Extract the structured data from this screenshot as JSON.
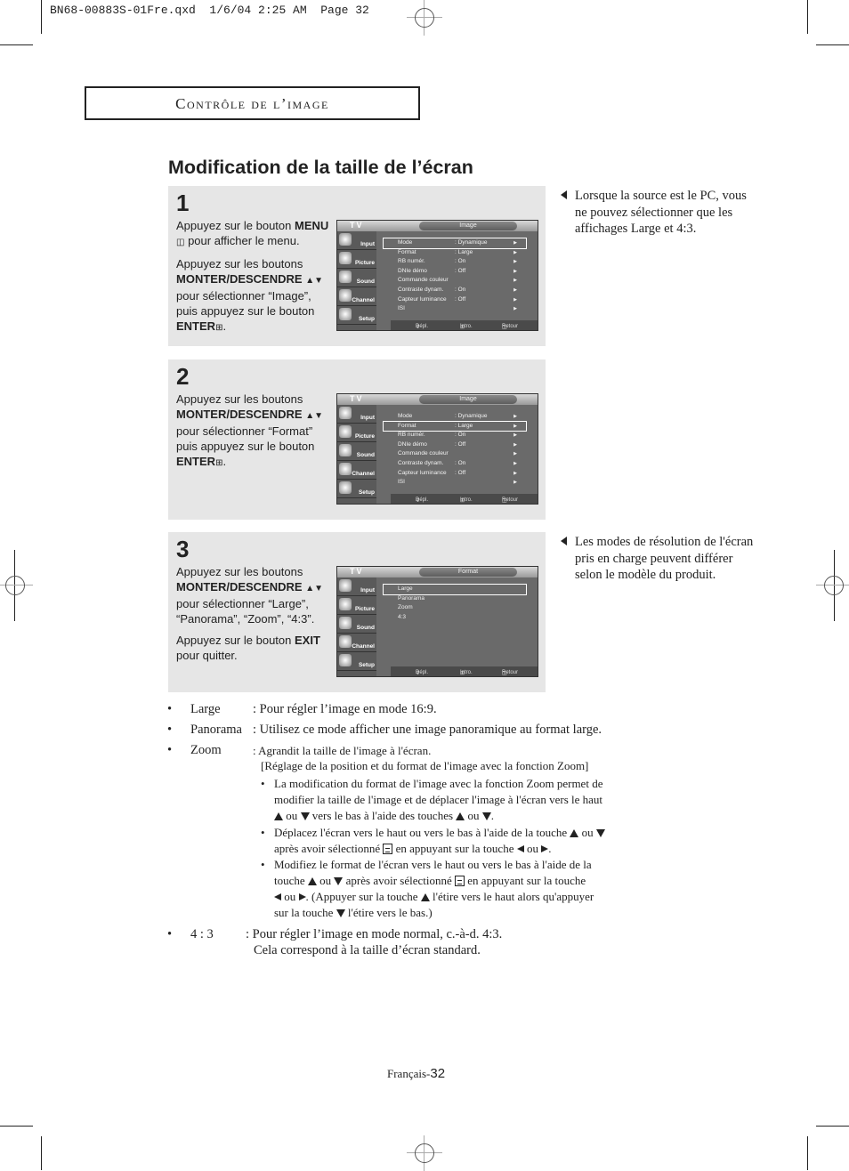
{
  "slug": "BN68-00883S-01Fre.qxd  1/6/04 2:25 AM  Page 32",
  "section_header": "Contrôle de l’image",
  "page_title": "Modification de la taille de l’écran",
  "steps": [
    {
      "number": "1",
      "paragraphs": [
        {
          "pre": "Appuyez sur le bouton ",
          "bold": "MENU",
          "icon": "menu-icon",
          "post": " pour afficher le menu."
        },
        {
          "pre": "Appuyez sur les boutons ",
          "bold": "MONTER/DESCENDRE",
          "icon": "up-down-icon",
          "post": " pour sélectionner “Image”, puis appuyez sur le bouton ",
          "bold2": "ENTER",
          "icon2": "enter-icon",
          "post2": "."
        }
      ],
      "screen": {
        "label": "TV",
        "tab": "Image",
        "rows": [
          {
            "key": "Mode",
            "value": ": Dynamique",
            "selected": true
          },
          {
            "key": "Format",
            "value": ": Large"
          },
          {
            "key": "RB numér.",
            "value": ": On"
          },
          {
            "key": "DNIe démo",
            "value": ": Off"
          },
          {
            "key": "Commande couleur",
            "value": ""
          },
          {
            "key": "Contraste dynam.",
            "value": ": On"
          },
          {
            "key": "Capteur luminance",
            "value": ": Off"
          },
          {
            "key": "ISI",
            "value": ""
          }
        ]
      }
    },
    {
      "number": "2",
      "paragraphs": [
        {
          "pre": "Appuyez sur les boutons ",
          "bold": "MONTER/DESCENDRE",
          "icon": "up-down-icon",
          "post": " pour sélectionner “Format” puis appuyez sur le bouton ",
          "bold2": "ENTER",
          "icon2": "enter-icon",
          "post2": "."
        }
      ],
      "screen": {
        "label": "TV",
        "tab": "Image",
        "rows": [
          {
            "key": "Mode",
            "value": ": Dynamique"
          },
          {
            "key": "Format",
            "value": ": Large",
            "selected": true
          },
          {
            "key": "RB numér.",
            "value": ": On"
          },
          {
            "key": "DNIe démo",
            "value": ": Off"
          },
          {
            "key": "Commande couleur",
            "value": ""
          },
          {
            "key": "Contraste dynam.",
            "value": ": On"
          },
          {
            "key": "Capteur luminance",
            "value": ": Off"
          },
          {
            "key": "ISI",
            "value": ""
          }
        ]
      }
    },
    {
      "number": "3",
      "paragraphs": [
        {
          "pre": "Appuyez sur les boutons ",
          "bold": "MONTER/DESCENDRE",
          "icon": "up-down-icon",
          "post": " pour sélectionner “Large”, “Panorama”, “Zoom”, “4:3”."
        },
        {
          "pre": "Appuyez sur le bouton ",
          "bold": "EXIT",
          "post": " pour quitter."
        }
      ],
      "screen": {
        "label": "TV",
        "tab": "Format",
        "rows": [
          {
            "key": "Large",
            "value": "",
            "selected": true,
            "noarrow": true
          },
          {
            "key": "Panorama",
            "value": "",
            "noarrow": true
          },
          {
            "key": "Zoom",
            "value": "",
            "noarrow": true
          },
          {
            "key": "4:3",
            "value": "",
            "noarrow": true
          }
        ]
      }
    }
  ],
  "tv_sidebar": [
    "Input",
    "Picture",
    "Sound",
    "Channel",
    "Setup"
  ],
  "tv_footer": {
    "move": "Dépl.",
    "enter": "Intro.",
    "return": "Retour"
  },
  "notes": [
    "Lorsque la source est le PC, vous ne pouvez sélectionner que les affichages Large et 4:3.",
    "Les modes de résolution de l'écran pris en charge peuvent différer selon le modèle du produit."
  ],
  "modes": [
    {
      "term": "Large",
      "desc": ": Pour régler l’image en mode 16:9."
    },
    {
      "term": "Panorama",
      "desc": ": Utilisez ce mode afficher une image panoramique au format large."
    },
    {
      "term": "Zoom",
      "desc": ": Agrandit la taille de l'image à l'écran.",
      "desc2": "[Réglage de la position et du format de l'image avec la fonction Zoom]"
    },
    {
      "term": "4 : 3",
      "desc": ": Pour régler l’image en mode normal, c.-à-d. 4:3.",
      "desc2": "Cela correspond à la taille d’écran standard."
    }
  ],
  "zoom_subpoints": {
    "a1": "La modification du format de l'image avec la fonction Zoom permet de",
    "a2": "modifier la taille de l'image et de déplacer l'image à l'écran vers le haut",
    "a3_ou": "ou",
    "a3_mid": "vers le bas à l'aide des touches",
    "a3_ou2": "ou",
    "b1": "Déplacez l'écran vers le haut ou vers le bas à l'aide de la touche",
    "b1_ou": "ou",
    "b2_pre": "après avoir sélectionné",
    "b2_mid": "en appuyant sur la touche",
    "b2_ou": "ou",
    "c1": "Modifiez le format de l'écran vers le haut ou vers le bas à l'aide de la",
    "c2_pre": "touche",
    "c2_ou": "ou",
    "c2_mid": "après avoir sélectionné",
    "c2_post": "en appuyant sur la touche",
    "c3_ou": "ou",
    "c3_mid": ". (Appuyer sur la touche",
    "c3_post": "l'étire vers le haut alors qu'appuyer",
    "c4_pre": "sur la touche",
    "c4_post": "l'étire vers le bas.)"
  },
  "footer": {
    "lang": "Français-",
    "page": "32"
  }
}
